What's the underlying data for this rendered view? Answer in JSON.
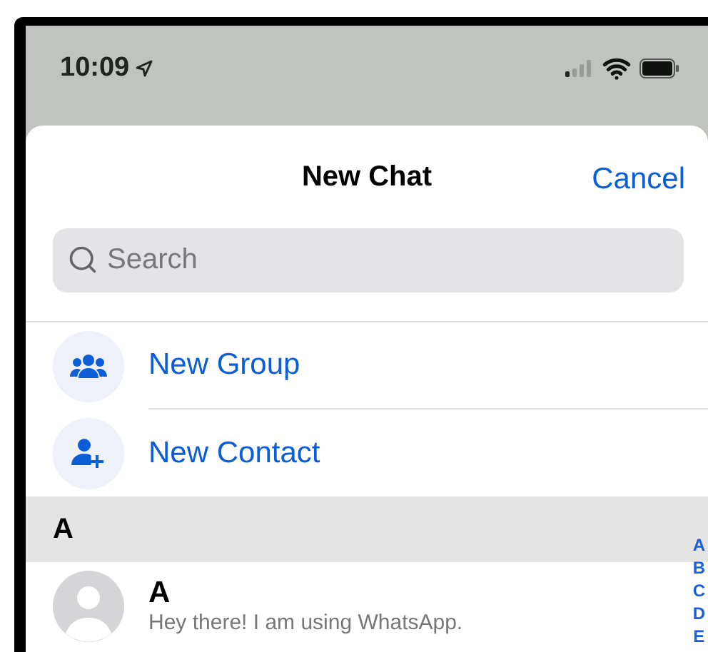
{
  "status_bar": {
    "time": "10:09"
  },
  "header": {
    "title": "New Chat",
    "cancel": "Cancel"
  },
  "search": {
    "placeholder": "Search"
  },
  "actions": [
    {
      "label": "New Group",
      "kind": "group"
    },
    {
      "label": "New Contact",
      "kind": "contact"
    }
  ],
  "sections": [
    {
      "letter": "A",
      "contacts": [
        {
          "name": "A",
          "status": "Hey there! I am using WhatsApp."
        }
      ]
    }
  ],
  "index": [
    "A",
    "B",
    "C",
    "D",
    "E"
  ]
}
